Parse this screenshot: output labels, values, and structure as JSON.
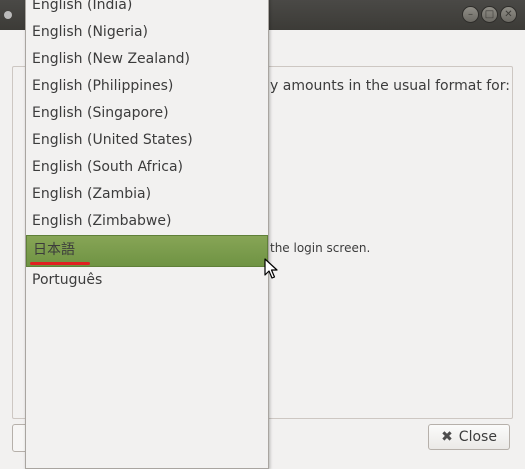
{
  "window": {
    "close_btn_glyph": "✕",
    "min_btn_glyph": "–",
    "max_btn_glyph": "□"
  },
  "background": {
    "format_text": "y amounts in the usual format for:",
    "login_text": "the login screen."
  },
  "language_list": {
    "items": [
      {
        "label": "English (India)"
      },
      {
        "label": "English (Nigeria)"
      },
      {
        "label": "English (New Zealand)"
      },
      {
        "label": "English (Philippines)"
      },
      {
        "label": "English (Singapore)"
      },
      {
        "label": "English (United States)"
      },
      {
        "label": "English (South Africa)"
      },
      {
        "label": "English (Zambia)"
      },
      {
        "label": "English (Zimbabwe)"
      },
      {
        "label": "日本語",
        "selected": true
      },
      {
        "label": "Português"
      }
    ]
  },
  "footer": {
    "close_label": "Close"
  },
  "colors": {
    "selection": "#7a9b4c",
    "spellcheck_underline": "#e02020"
  }
}
